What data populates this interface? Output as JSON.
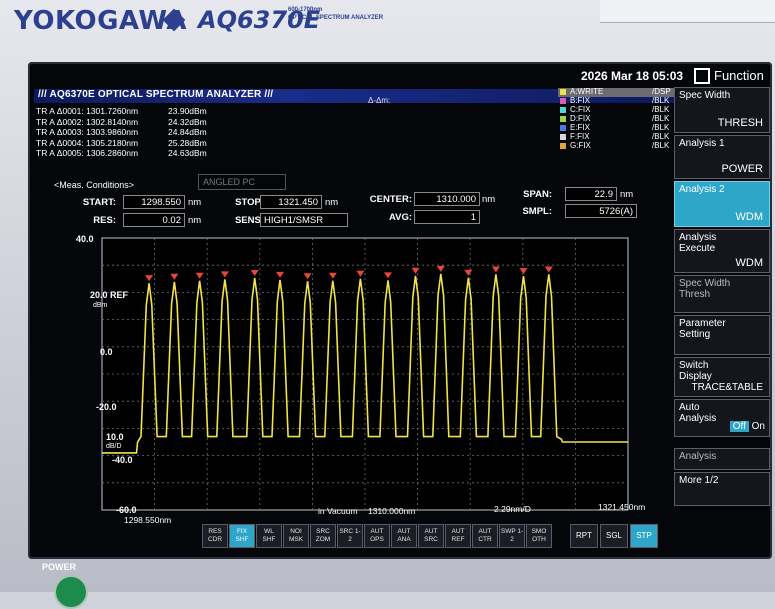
{
  "device": {
    "brand": "YOKOGAWA",
    "model": "AQ6370E",
    "model_sub_line1": "600-1700nm",
    "model_sub_line2": "OPTICAL SPECTRUM ANALYZER",
    "power_label": "POWER"
  },
  "header": {
    "title": "/// AQ6370E OPTICAL SPECTRUM ANALYZER ///",
    "delta_label": "Δ-Δm:",
    "datetime": "2026 Mar 18 05:03",
    "function_label": "Function"
  },
  "markers": [
    {
      "label": "TR A  Δ0001: 1301.7260nm",
      "value": "23.90dBm"
    },
    {
      "label": "TR A  Δ0002: 1302.8140nm",
      "value": "24.32dBm"
    },
    {
      "label": "TR A  Δ0003: 1303.9860nm",
      "value": "24.84dBm"
    },
    {
      "label": "TR A  Δ0004: 1305.2180nm",
      "value": "25.28dBm"
    },
    {
      "label": "TR A  Δ0005: 1306.2860nm",
      "value": "24.63dBm"
    }
  ],
  "traces": [
    {
      "name": "A:WRITE",
      "mode": "/DSP",
      "color": "#f1e34a",
      "active": true
    },
    {
      "name": "B:FIX",
      "mode": "/BLK",
      "color": "#e25ab8"
    },
    {
      "name": "C:FIX",
      "mode": "/BLK",
      "color": "#4fd6d8"
    },
    {
      "name": "D:FIX",
      "mode": "/BLK",
      "color": "#9ad84a"
    },
    {
      "name": "E:FIX",
      "mode": "/BLK",
      "color": "#4a7be2"
    },
    {
      "name": "F:FIX",
      "mode": "/BLK",
      "color": "#d8d8d8"
    },
    {
      "name": "G:FIX",
      "mode": "/BLK",
      "color": "#e6a23a"
    }
  ],
  "conditions": {
    "title": "<Meas. Conditions>",
    "angled_pc": "ANGLED PC",
    "start_label": "START:",
    "start": "1298.550",
    "start_unit": "nm",
    "stop_label": "STOP:",
    "stop": "1321.450",
    "stop_unit": "nm",
    "center_label": "CENTER:",
    "center": "1310.000",
    "center_unit": "nm",
    "span_label": "SPAN:",
    "span": "22.9",
    "span_unit": "nm",
    "res_label": "RES:",
    "res": "0.02",
    "res_unit": "nm",
    "sens_label": "SENS:",
    "sens": "HIGH1/SMSR",
    "avg_label": "AVG:",
    "avg": "1",
    "smpl_label": "SMPL:",
    "smpl": "5726(A)"
  },
  "softkeys": [
    {
      "title": "Spec Width",
      "value": "THRESH"
    },
    {
      "title": "Analysis 1",
      "value": "POWER"
    },
    {
      "title": "Analysis 2",
      "value": "WDM",
      "selected": true
    },
    {
      "title": "Analysis Execute",
      "value": "WDM"
    },
    {
      "title": "Spec Width Thresh",
      "value": ""
    },
    {
      "title": "Parameter Setting",
      "value": ""
    },
    {
      "title": "Switch Display",
      "value": "TRACE&TABLE"
    },
    {
      "title": "Auto Analysis",
      "toggle_off": "Off",
      "toggle_on": "On"
    },
    {
      "title": "Analysis",
      "value": ""
    },
    {
      "title": "More 1/2",
      "value": ""
    }
  ],
  "bottom_buttons": [
    "RES CDR",
    "FIX SHF",
    "WL SHF",
    "NOI MSK",
    "SRC ZOM",
    "SRC 1-2",
    "AUT OPS",
    "AUT ANA",
    "AUT SRC",
    "AUT REF",
    "AUT CTR",
    "SWP 1-2",
    "SMO OTH"
  ],
  "right_buttons": [
    "RPT",
    "SGL",
    "STP"
  ],
  "plot": {
    "y_top": "40.0",
    "y_ref": "20.0 REF",
    "y_ref_unit": "dBm",
    "y_mid": "0.0",
    "y_m20": "-20.0",
    "y_m40": "-40.0",
    "y_bot": "-60.0",
    "y_scale_value": "10.0",
    "y_scale_unit": "dB/D",
    "x_start": "1298.550nm",
    "x_center": "1310.000nm",
    "x_center_prefix": "in Vacuum",
    "x_scale": "2.29nm/D",
    "x_stop": "1321.450nm"
  },
  "chart_data": {
    "type": "line",
    "xlabel": "",
    "ylabel": "",
    "xlim": [
      1298.55,
      1321.45
    ],
    "ylim": [
      -60,
      40
    ],
    "series": [
      {
        "name": "A:WRITE",
        "peaks_x": [
          1300.6,
          1301.7,
          1302.8,
          1303.9,
          1305.2,
          1306.3,
          1307.5,
          1308.6,
          1309.8,
          1311.0,
          1312.2,
          1313.3,
          1314.5,
          1315.7,
          1316.9,
          1318.0
        ],
        "peaks_y": [
          23.4,
          23.9,
          24.3,
          24.8,
          25.3,
          24.6,
          24.1,
          24.3,
          25.0,
          24.4,
          26.1,
          26.8,
          25.4,
          26.6,
          26.0,
          26.6
        ],
        "noise_floor_left": -39,
        "valley": -33,
        "noise_floor_right": -35
      }
    ]
  }
}
